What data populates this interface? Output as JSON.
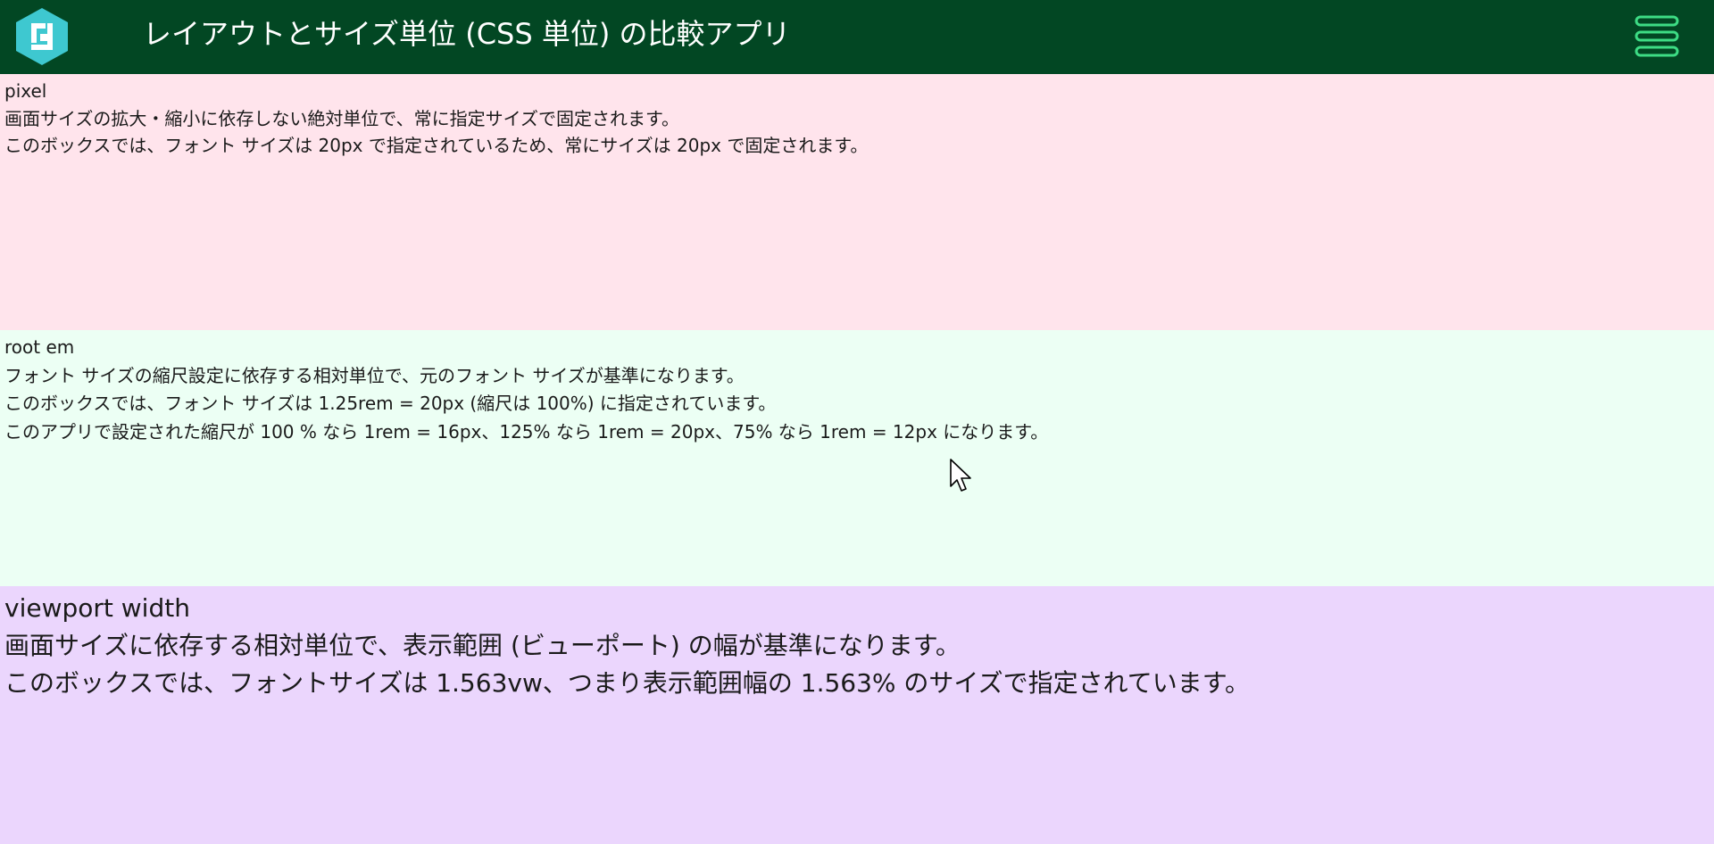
{
  "header": {
    "title": "レイアウトとサイズ単位 (CSS 単位) の比較アプリ",
    "logo_icon": "app-logo-icon",
    "menu_icon": "hamburger-menu-icon",
    "bg_color": "#024723",
    "menu_color": "#3ddc84",
    "logo_color": "#3ec8d0"
  },
  "sections": {
    "pixel": {
      "heading": "pixel",
      "lines": [
        "画面サイズの拡大・縮小に依存しない絶対単位で、常に指定サイズで固定されます。",
        "このボックスでは、フォント サイズは 20px で指定されているため、常にサイズは 20px で固定されます。"
      ],
      "bg_color": "#ffe4ec"
    },
    "rem": {
      "heading": "root em",
      "lines": [
        "フォント サイズの縮尺設定に依存する相対単位で、元のフォント サイズが基準になります。",
        "このボックスでは、フォント サイズは 1.25rem = 20px (縮尺は 100%) に指定されています。",
        "このアプリで設定された縮尺が 100 % なら 1rem = 16px、125% なら 1rem = 20px、75% なら 1rem = 12px になります。"
      ],
      "bg_color": "#ecfff4"
    },
    "vw": {
      "heading": "viewport width",
      "lines": [
        "画面サイズに依存する相対単位で、表示範囲 (ビューポート) の幅が基準になります。",
        "このボックスでは、フォントサイズは 1.563vw、つまり表示範囲幅の 1.563% のサイズで指定されています。"
      ],
      "bg_color": "#ebd6fd"
    }
  }
}
